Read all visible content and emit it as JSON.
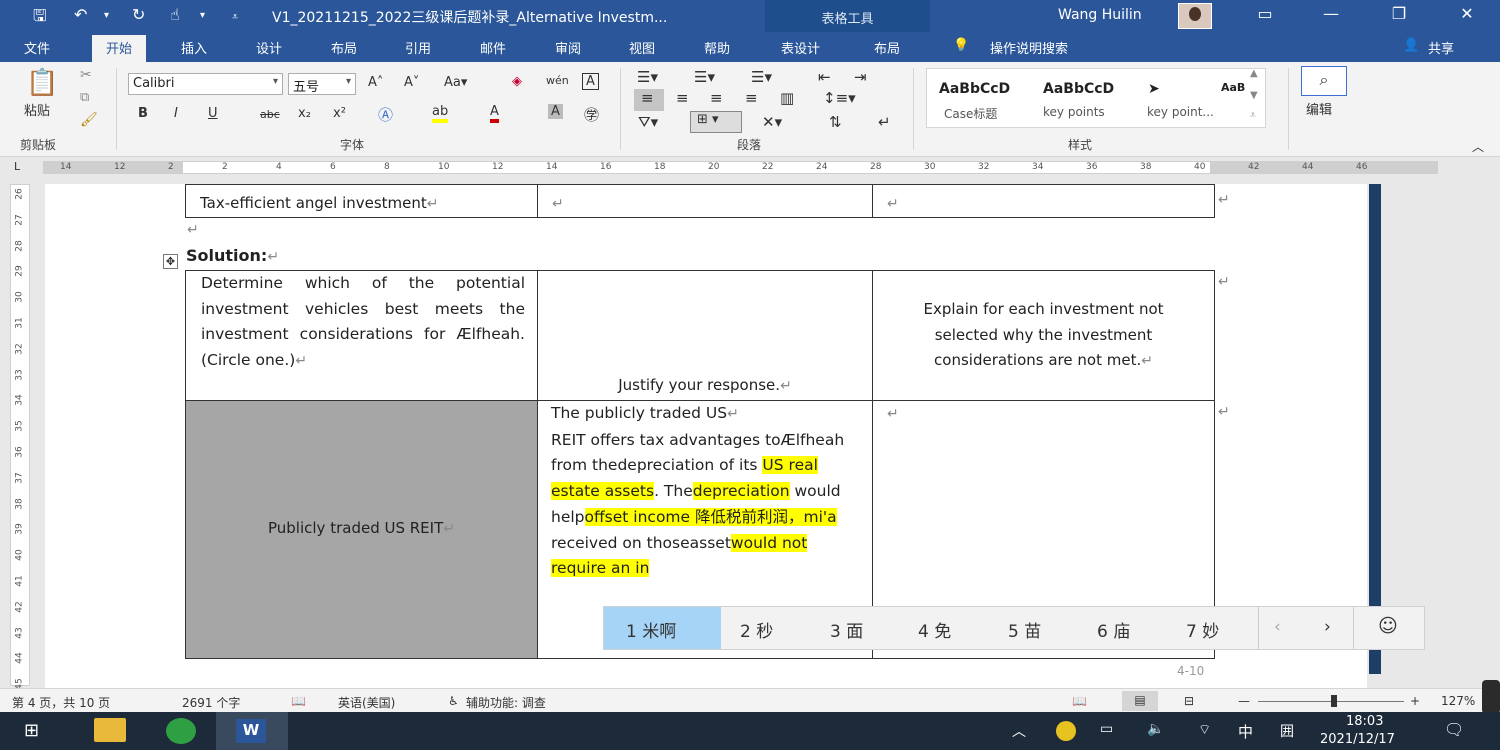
{
  "titlebar": {
    "doc_title": "V1_20211215_2022三级课后题补录_Alternative Investm...",
    "context_tab": "表格工具",
    "user_name": "Wang Huilin"
  },
  "menu": [
    "文件",
    "开始",
    "插入",
    "设计",
    "布局",
    "引用",
    "邮件",
    "审阅",
    "视图",
    "帮助",
    "表设计",
    "布局"
  ],
  "search_label": "操作说明搜索",
  "share_label": "共享",
  "ribbon": {
    "paste_label": "粘贴",
    "clipboard_label": "剪贴板",
    "font_name": "Calibri",
    "font_size": "五号",
    "font_label": "字体",
    "paragraph_label": "段落",
    "styles_label": "样式",
    "edit_label": "编辑",
    "styles": [
      {
        "sample": "AaBbCcD",
        "name": "Case标题"
      },
      {
        "sample": "AaBbCcD",
        "name": "key points"
      },
      {
        "sample": "➤",
        "name": "key point..."
      }
    ],
    "style_extra": "AaB"
  },
  "ruler": [
    "14",
    "12",
    "2",
    "2",
    "4",
    "6",
    "8",
    "10",
    "12",
    "14",
    "16",
    "18",
    "20",
    "22",
    "24",
    "28",
    "30",
    "32",
    "34",
    "36",
    "38",
    "40",
    "42",
    "44",
    "46"
  ],
  "vruler": [
    "26",
    "27",
    "28",
    "29",
    "30",
    "31",
    "32",
    "33",
    "34",
    "35",
    "36",
    "37",
    "38",
    "39",
    "40",
    "41",
    "42",
    "43",
    "44",
    "45"
  ],
  "doc": {
    "top_row_first": "Tax-efficient angel investment",
    "solution": "Solution:",
    "header_col1": "Determine which of the potential investment vehicles best meets the investment considerations for Ælfheah. (Circle one.)",
    "header_col2": "Justify your response.",
    "header_col3": "Explain for each investment not selected why the investment considerations are not met.",
    "row_col1": "Publicly traded US REIT",
    "row_col2_parts": [
      {
        "t": "The publicly traded US",
        "hl": false
      },
      {
        "t": "REIT offers tax advantages to",
        "hl": false
      },
      {
        "t": "Ælfheah from the",
        "hl": false
      },
      {
        "t": "depreciation of its ",
        "hl": false
      },
      {
        "t": "US real estate assets",
        "hl": true
      },
      {
        "t": ". The",
        "hl": false
      },
      {
        "t": "depreciation",
        "hl": true
      },
      {
        "t": " would help",
        "hl": false
      },
      {
        "t": "offset income 降低税前利润，",
        "hl": true
      },
      {
        "t": "mi'a",
        "hl": true
      },
      {
        "t": " received on those",
        "hl": false
      },
      {
        "t": "asset",
        "hl": false
      },
      {
        "t": "would not require an in",
        "hl": true
      }
    ]
  },
  "ime": {
    "candidates": [
      "1 米啊",
      "2 秒",
      "3 面",
      "4 免",
      "5 苗",
      "6 庙",
      "7 妙"
    ]
  },
  "page_num_marker": "4-10",
  "status": {
    "page": "第 4 页，共 10 页",
    "words": "2691 个字",
    "lang": "英语(美国)",
    "access": "辅助功能: 调查",
    "zoom": "127%"
  },
  "taskbar": {
    "ime_mode": "中",
    "time": "18:03",
    "date": "2021/12/17"
  }
}
